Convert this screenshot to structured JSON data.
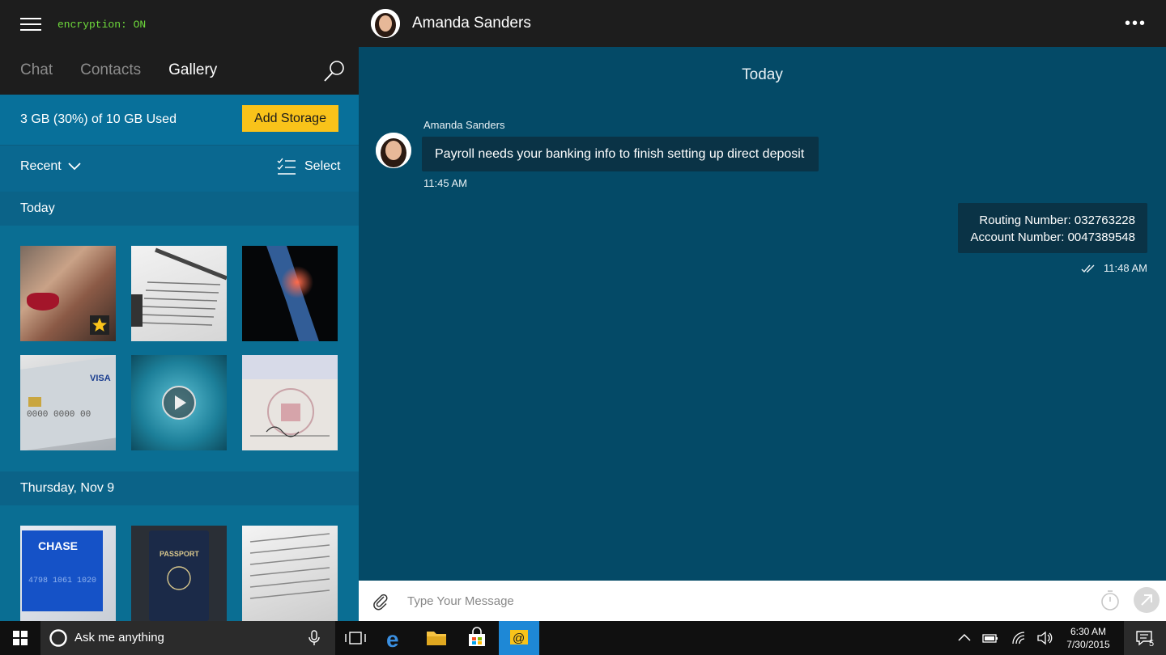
{
  "app": {
    "encryption_status": "encryption: ON",
    "tabs": [
      {
        "label": "Chat",
        "active": false
      },
      {
        "label": "Contacts",
        "active": false
      },
      {
        "label": "Gallery",
        "active": true
      }
    ]
  },
  "gallery": {
    "storage_text": "3 GB (30%) of 10 GB Used",
    "storage_used_fraction": 0.3,
    "add_storage_label": "Add Storage",
    "filter_label": "Recent",
    "select_label": "Select",
    "sections": [
      {
        "label": "Today"
      },
      {
        "label": "Thursday, Nov 9"
      }
    ]
  },
  "conversation": {
    "contact_name": "Amanda Sanders",
    "day_label": "Today",
    "incoming": {
      "sender": "Amanda Sanders",
      "text": "Payroll needs your banking info to finish setting up direct deposit",
      "time": "11:45 AM"
    },
    "outgoing": {
      "line1": "Routing Number: 032763228",
      "line2": "Account Number: 0047389548",
      "time": "11:48 AM"
    },
    "composer_placeholder": "Type Your Message"
  },
  "taskbar": {
    "search_text": "Ask me anything",
    "clock_time": "6:30 AM",
    "clock_date": "7/30/2015",
    "notification_count": "5"
  },
  "colors": {
    "accent_yellow": "#f9c31a",
    "encryption_green": "#6fdc3c",
    "gallery_blue": "#0a6e93",
    "chat_blue": "#044a67",
    "bubble": "#0a3346"
  }
}
